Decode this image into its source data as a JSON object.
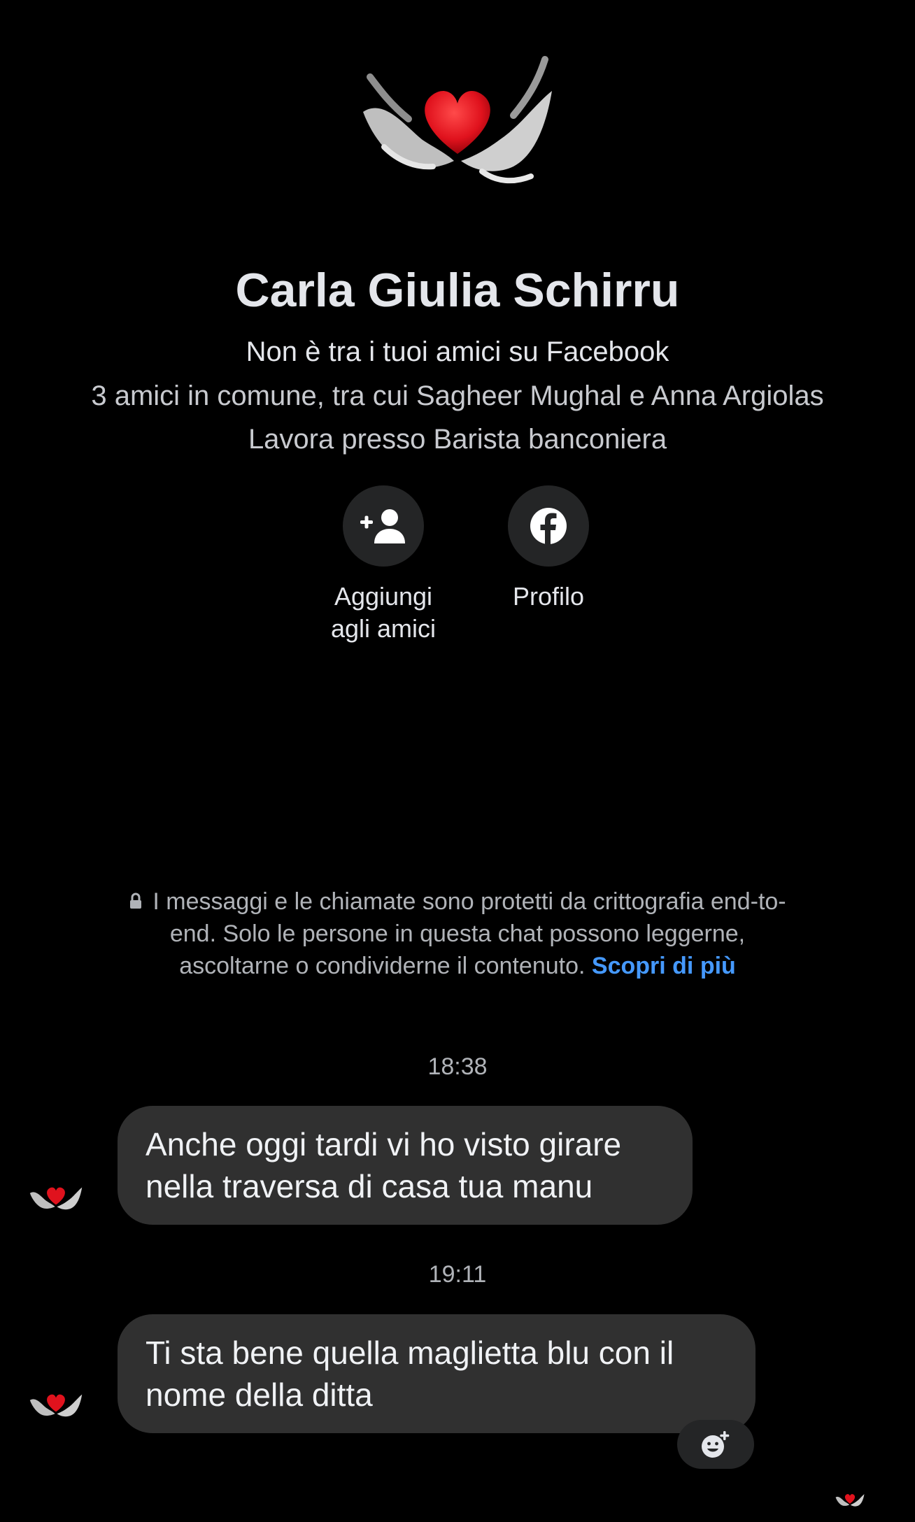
{
  "profile": {
    "avatar_icon": "heart-in-hands-icon",
    "name": "Carla Giulia Schirru",
    "not_friends": "Non è tra i tuoi amici su Facebook",
    "mutual_friends": "3 amici in comune, tra cui Sagheer Mughal e Anna Argiolas",
    "work": "Lavora presso Barista banconiera"
  },
  "actions": {
    "add_friend": {
      "label_line1": "Aggiungi",
      "label_line2": "agli amici",
      "icon": "add-friend-icon"
    },
    "profile": {
      "label": "Profilo",
      "icon": "facebook-icon"
    }
  },
  "encryption": {
    "icon": "lock-icon",
    "text": "I messaggi e le chiamate sono protetti da crittografia end-to-end. Solo le persone in questa chat possono leggerne, ascoltarne o condividerne il contenuto.",
    "link": "Scopri di più"
  },
  "messages": [
    {
      "time": "18:38",
      "text": "Anche oggi tardi vi ho visto girare nella traversa di casa tua manu"
    },
    {
      "time": "19:11",
      "text": "Ti sta bene quella maglietta blu con il nome della ditta"
    }
  ],
  "reaction": {
    "icon": "add-reaction-icon"
  },
  "colors": {
    "background": "#000000",
    "bubble": "#303030",
    "link": "#4599ff",
    "heart": "#e0121d"
  }
}
